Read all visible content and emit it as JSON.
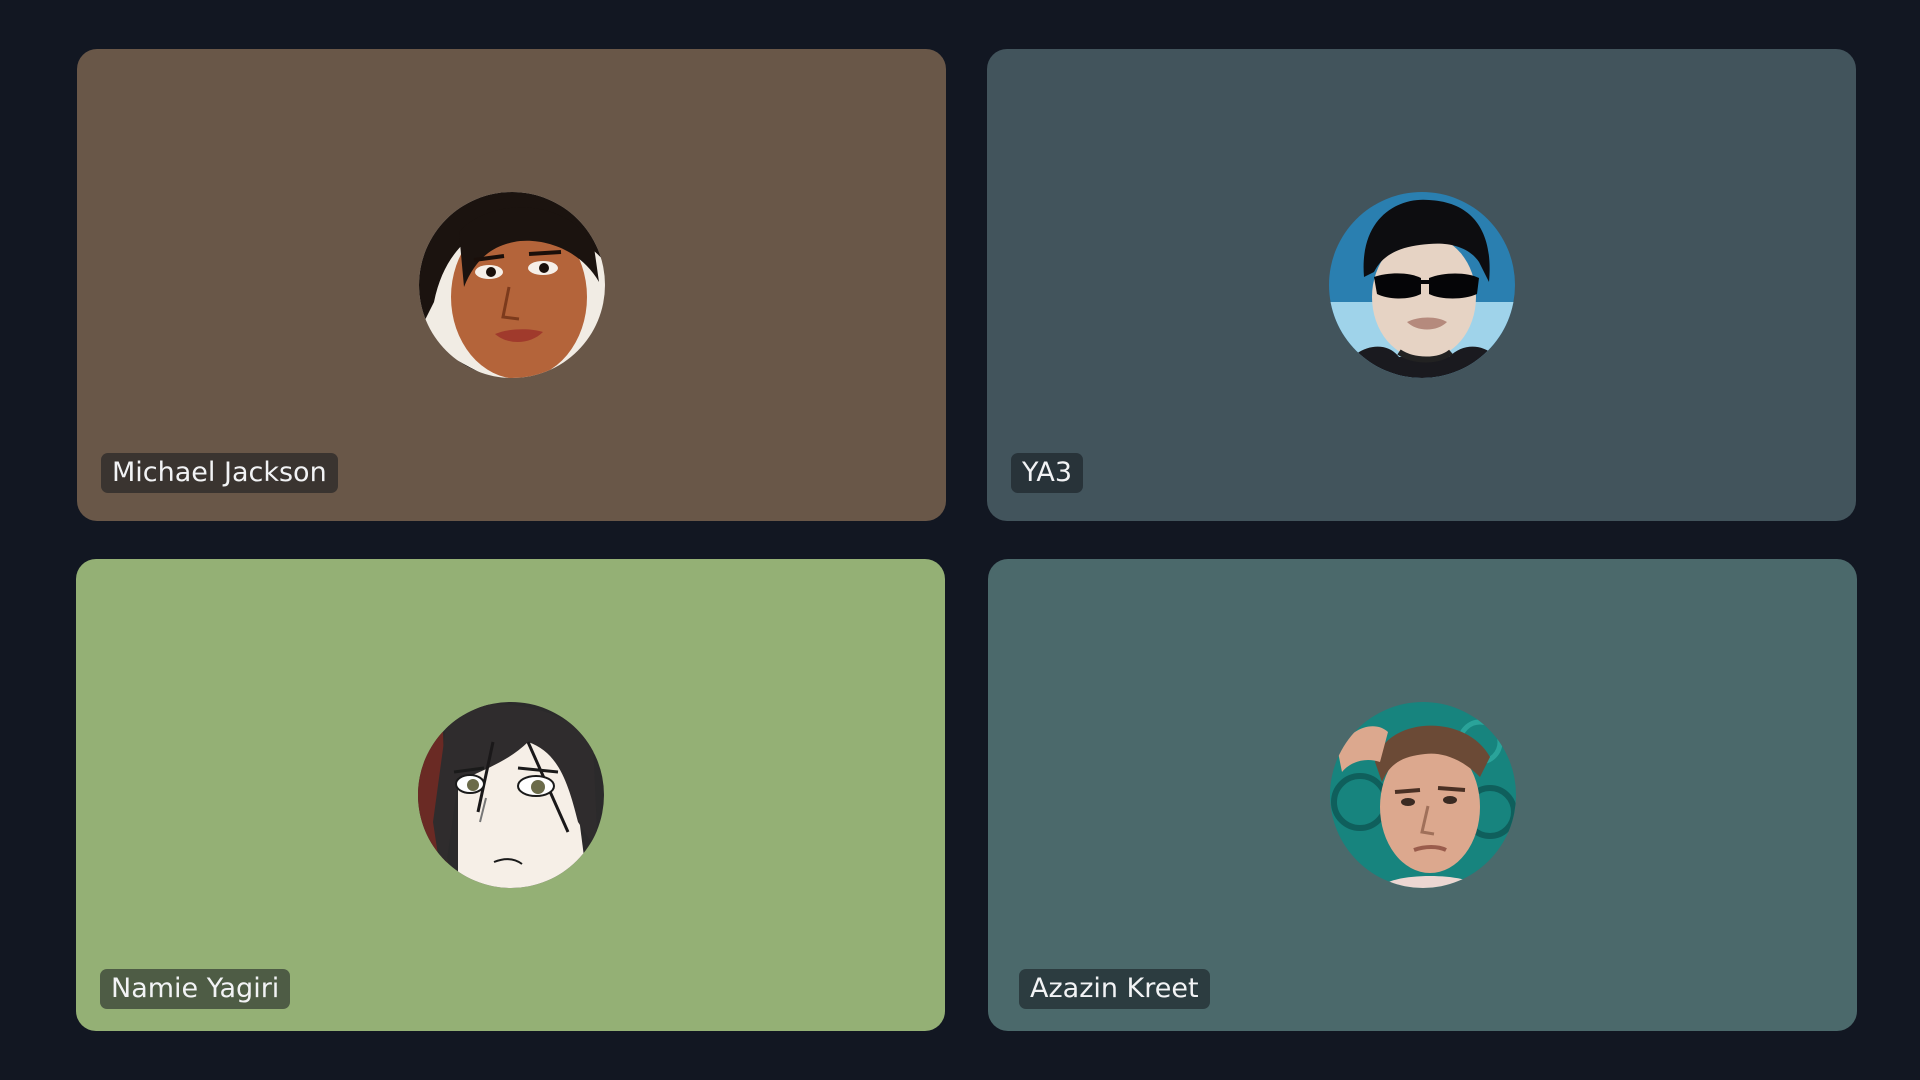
{
  "participants": [
    {
      "name": "Michael Jackson",
      "tile_color": "#695748",
      "avatar": "portrait-curly-dark-hair-icon"
    },
    {
      "name": "YA3",
      "tile_color": "#42545c",
      "avatar": "portrait-sunglasses-icon"
    },
    {
      "name": "Namie Yagiri",
      "tile_color": "#94b075",
      "avatar": "anime-portrait-icon"
    },
    {
      "name": "Azazin Kreet",
      "tile_color": "#4b696b",
      "avatar": "portrait-teal-pillow-icon"
    }
  ],
  "colors": {
    "background": "#121722",
    "name_tag_text": "#f2f3f5"
  }
}
